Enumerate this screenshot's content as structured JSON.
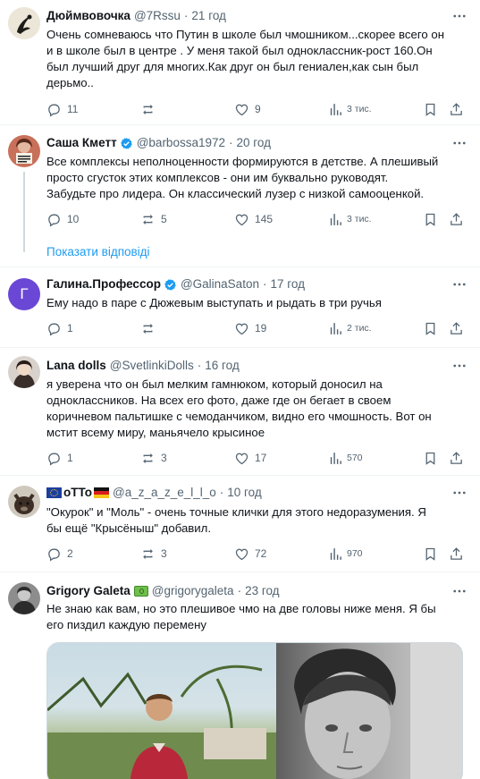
{
  "icons": {
    "reply": "reply-icon",
    "retweet": "retweet-icon",
    "like": "heart-icon",
    "views": "views-chart-icon",
    "bookmark": "bookmark-icon",
    "share": "share-icon",
    "more": "more-icon",
    "verified": "verified-badge-icon"
  },
  "colors": {
    "link": "#1d9bf0",
    "muted": "#536471",
    "verified": "#1d9bf0"
  },
  "show_replies_label": "Показати відповіді",
  "tweets": [
    {
      "name": "Дюймвовочка",
      "handle": "@7Rssu",
      "time": "21 год",
      "text": "Очень сомневаюсь что Путин в школе был чмошником...скорее всего он\nи в школе был в центре . У меня такой был одноклассник-рост 160.Он\nбыл лучший друг для многих.Как друг он был гениален,как сын был\nдерьмо..",
      "replies": "11",
      "retweets": "",
      "likes": "9",
      "views": "3 тис."
    },
    {
      "name": "Саша Кметт",
      "handle": "@barbossa1972",
      "time": "20 год",
      "text": "Все комплексы неполноценности формируются в детстве. А плешивый\nпросто сгусток этих комплексов - они им буквально руководят.\nЗабудьте про лидера. Он классический лузер с низкой самооценкой.",
      "replies": "10",
      "retweets": "5",
      "likes": "145",
      "views": "3 тис."
    },
    {
      "name": "Галина.Профессор",
      "avatar_letter": "Г",
      "handle": "@GalinaSaton",
      "time": "17 год",
      "text": "Ему надо в паре с Дюжевым выступать и рыдать в три ручья",
      "replies": "1",
      "retweets": "",
      "likes": "19",
      "views": "2 тис."
    },
    {
      "name": "Lana dolls",
      "handle": "@SvetlinkiDolls",
      "time": "16 год",
      "text": "я уверена что он был мелким гамнюком, который доносил на\nодноклассников. На всех его фото, даже где он бегает в своем\nкоричневом пальтишке с чемоданчиком, видно его чмошность. Вот он\nмстит всему миру, маньячело крысиное",
      "replies": "1",
      "retweets": "3",
      "likes": "17",
      "views": "570"
    },
    {
      "name": "oTTo",
      "handle": "@a_z_a_z_e_l_l_o",
      "time": "10 год",
      "text": "\"Окурок\" и \"Моль\" - очень точные клички для этого недоразумения. Я\nбы ещё \"Крысёныш\" добавил.",
      "replies": "2",
      "retweets": "3",
      "likes": "72",
      "views": "970"
    },
    {
      "name": "Grigory Galeta",
      "handle": "@grigorygaleta",
      "time": "23 год",
      "text": "Не знаю как вам, но это плешивое чмо на две головы ниже меня. Я бы\nего пиздил каждую перемену"
    }
  ]
}
